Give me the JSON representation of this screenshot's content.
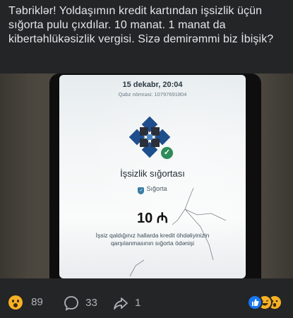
{
  "post": {
    "text": "Təbriklər! Yoldaşımın kredit kartından işsizlik üçün sığorta pulu çıxdılar. 10 manat. 1 manat da kibertəhlükəsizlik vergisi. Sizə demirəmmi biz İbişik?"
  },
  "phone_screen": {
    "date": "15 dekabr, 20:04",
    "receipt": "Qəbz nömrəsi: 10797691804",
    "title": "İşsizlik sığortası",
    "category": "Sığorta",
    "amount": "10 ₼",
    "description": "İşsiz qaldığınız hallarda kredit öhdəliyinizin qarşılanmasının sığorta ödənişi"
  },
  "reactions": {
    "reaction_count": "89",
    "comment_count": "33",
    "share_count": "1",
    "icons": [
      "wow-emoji-icon",
      "comment-icon",
      "share-icon",
      "like-icon",
      "haha-icon",
      "wow-icon"
    ]
  },
  "colors": {
    "background": "#242526",
    "text": "#e4e6eb",
    "muted": "#b0b3b8",
    "logo_blue": "#1f4e8c",
    "check_green": "#2e8b57",
    "wow_yellow": "#f7b125",
    "like_blue": "#1877f2"
  }
}
